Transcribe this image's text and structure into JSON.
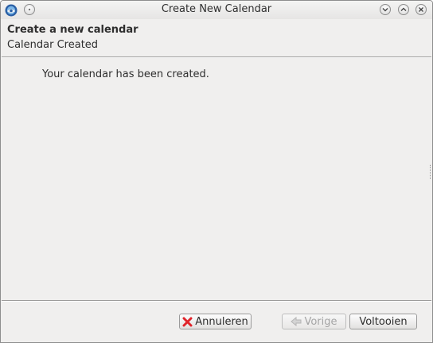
{
  "window": {
    "title": "Create New Calendar"
  },
  "header": {
    "title": "Create a new calendar",
    "subtitle": "Calendar Created"
  },
  "main": {
    "message": "Your calendar has been created."
  },
  "buttons": {
    "cancel_label": "Annuleren",
    "back_label": "Vorige",
    "finish_label": "Voltooien"
  },
  "icons": {
    "app": "thunderbird-app-icon",
    "sticky": "sticky-icon",
    "minimize": "minimize-icon",
    "maximize": "maximize-icon",
    "close": "close-icon",
    "cancel": "cancel-x-icon",
    "back": "back-arrow-icon"
  },
  "colors": {
    "window_bg": "#f0efee",
    "cancel_icon": "#e0242b"
  }
}
